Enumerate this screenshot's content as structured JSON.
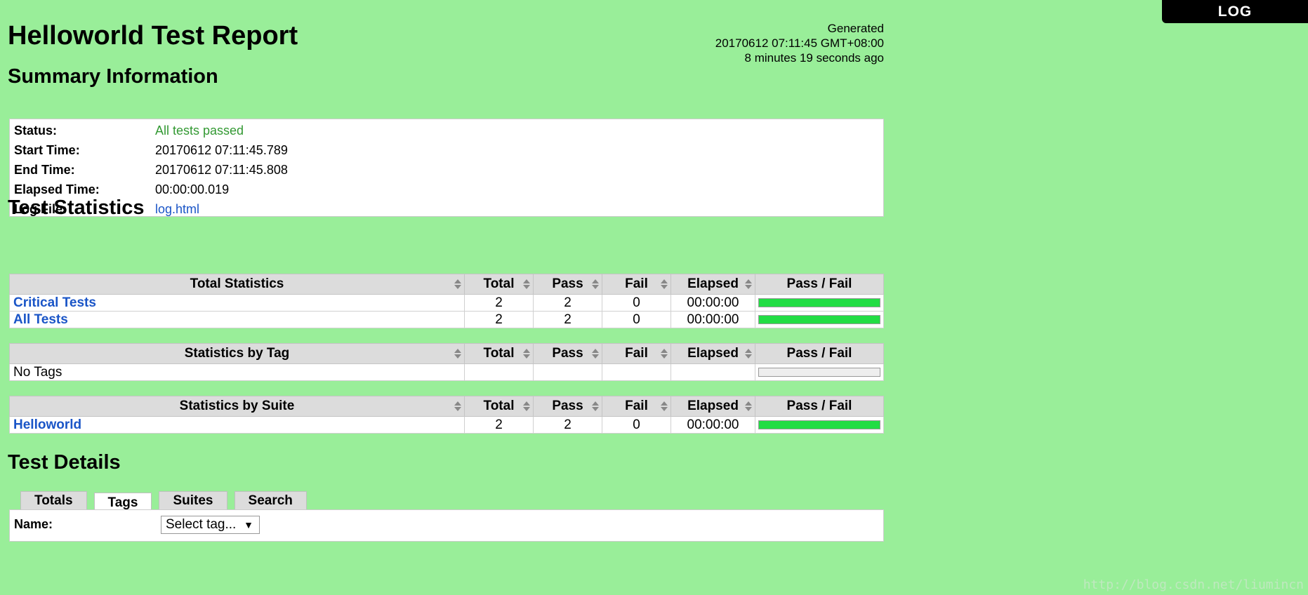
{
  "header": {
    "log_button": "LOG",
    "title": "Helloworld Test Report",
    "generated_label": "Generated",
    "generated_time": "20170612 07:11:45 GMT+08:00",
    "generated_ago": "8 minutes 19 seconds ago"
  },
  "summary": {
    "heading": "Summary Information",
    "rows": [
      {
        "label": "Status:",
        "value": "All tests passed"
      },
      {
        "label": "Start Time:",
        "value": "20170612 07:11:45.789"
      },
      {
        "label": "End Time:",
        "value": "20170612 07:11:45.808"
      },
      {
        "label": "Elapsed Time:",
        "value": "00:00:00.019"
      },
      {
        "label": "Log File:",
        "value": "log.html"
      }
    ]
  },
  "statistics": {
    "heading": "Test Statistics",
    "columns": {
      "total": "Total",
      "pass": "Pass",
      "fail": "Fail",
      "elapsed": "Elapsed",
      "passfail": "Pass / Fail"
    },
    "total_table": {
      "title": "Total Statistics",
      "rows": [
        {
          "name": "Critical Tests",
          "total": "2",
          "pass": "2",
          "fail": "0",
          "elapsed": "00:00:00",
          "pass_fraction": 1.0
        },
        {
          "name": "All Tests",
          "total": "2",
          "pass": "2",
          "fail": "0",
          "elapsed": "00:00:00",
          "pass_fraction": 1.0
        }
      ]
    },
    "tag_table": {
      "title": "Statistics by Tag",
      "rows": [
        {
          "name": "No Tags",
          "total": "",
          "pass": "",
          "fail": "",
          "elapsed": "",
          "pass_fraction": 0
        }
      ]
    },
    "suite_table": {
      "title": "Statistics by Suite",
      "rows": [
        {
          "name": "Helloworld",
          "total": "2",
          "pass": "2",
          "fail": "0",
          "elapsed": "00:00:00",
          "pass_fraction": 1.0
        }
      ]
    }
  },
  "details": {
    "heading": "Test Details",
    "tabs": [
      "Totals",
      "Tags",
      "Suites",
      "Search"
    ],
    "active_tab": "Tags",
    "name_label": "Name:",
    "select_value": "Select tag..."
  },
  "watermark": "http://blog.csdn.net/liumincn",
  "colors": {
    "background": "#99ee99",
    "pass_bar": "#22dd44",
    "link": "#1a55c7",
    "status_pass": "#339933"
  }
}
